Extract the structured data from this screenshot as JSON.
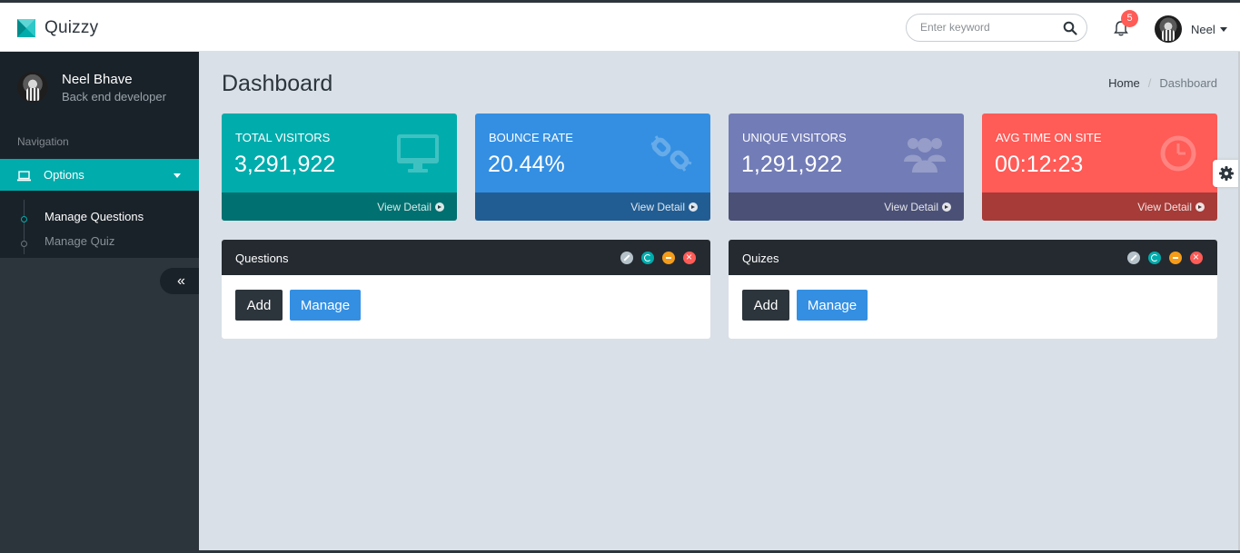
{
  "header": {
    "brand": "Quizzy",
    "search_placeholder": "Enter keyword",
    "notifications_count": "5",
    "user_name": "Neel"
  },
  "sidebar": {
    "profile_name": "Neel Bhave",
    "profile_role": "Back end developer",
    "nav_header": "Navigation",
    "menu_label": "Options",
    "submenu": [
      {
        "label": "Manage Questions"
      },
      {
        "label": "Manage Quiz"
      }
    ]
  },
  "page": {
    "title": "Dashboard",
    "breadcrumb": [
      "Home",
      "Dashboard"
    ]
  },
  "stats": [
    {
      "label": "TOTAL VISITORS",
      "value": "3,291,922",
      "link": "View Detail",
      "icon": "desktop-icon",
      "color": "#00acac"
    },
    {
      "label": "BOUNCE RATE",
      "value": "20.44%",
      "link": "View Detail",
      "icon": "broken-link-icon",
      "color": "#348fe2"
    },
    {
      "label": "UNIQUE VISITORS",
      "value": "1,291,922",
      "link": "View Detail",
      "icon": "users-icon",
      "color": "#727cb6"
    },
    {
      "label": "AVG TIME ON SITE",
      "value": "00:12:23",
      "link": "View Detail",
      "icon": "clock-icon",
      "color": "#ff5b57"
    }
  ],
  "panels": [
    {
      "title": "Questions",
      "add_label": "Add",
      "manage_label": "Manage"
    },
    {
      "title": "Quizes",
      "add_label": "Add",
      "manage_label": "Manage"
    }
  ]
}
